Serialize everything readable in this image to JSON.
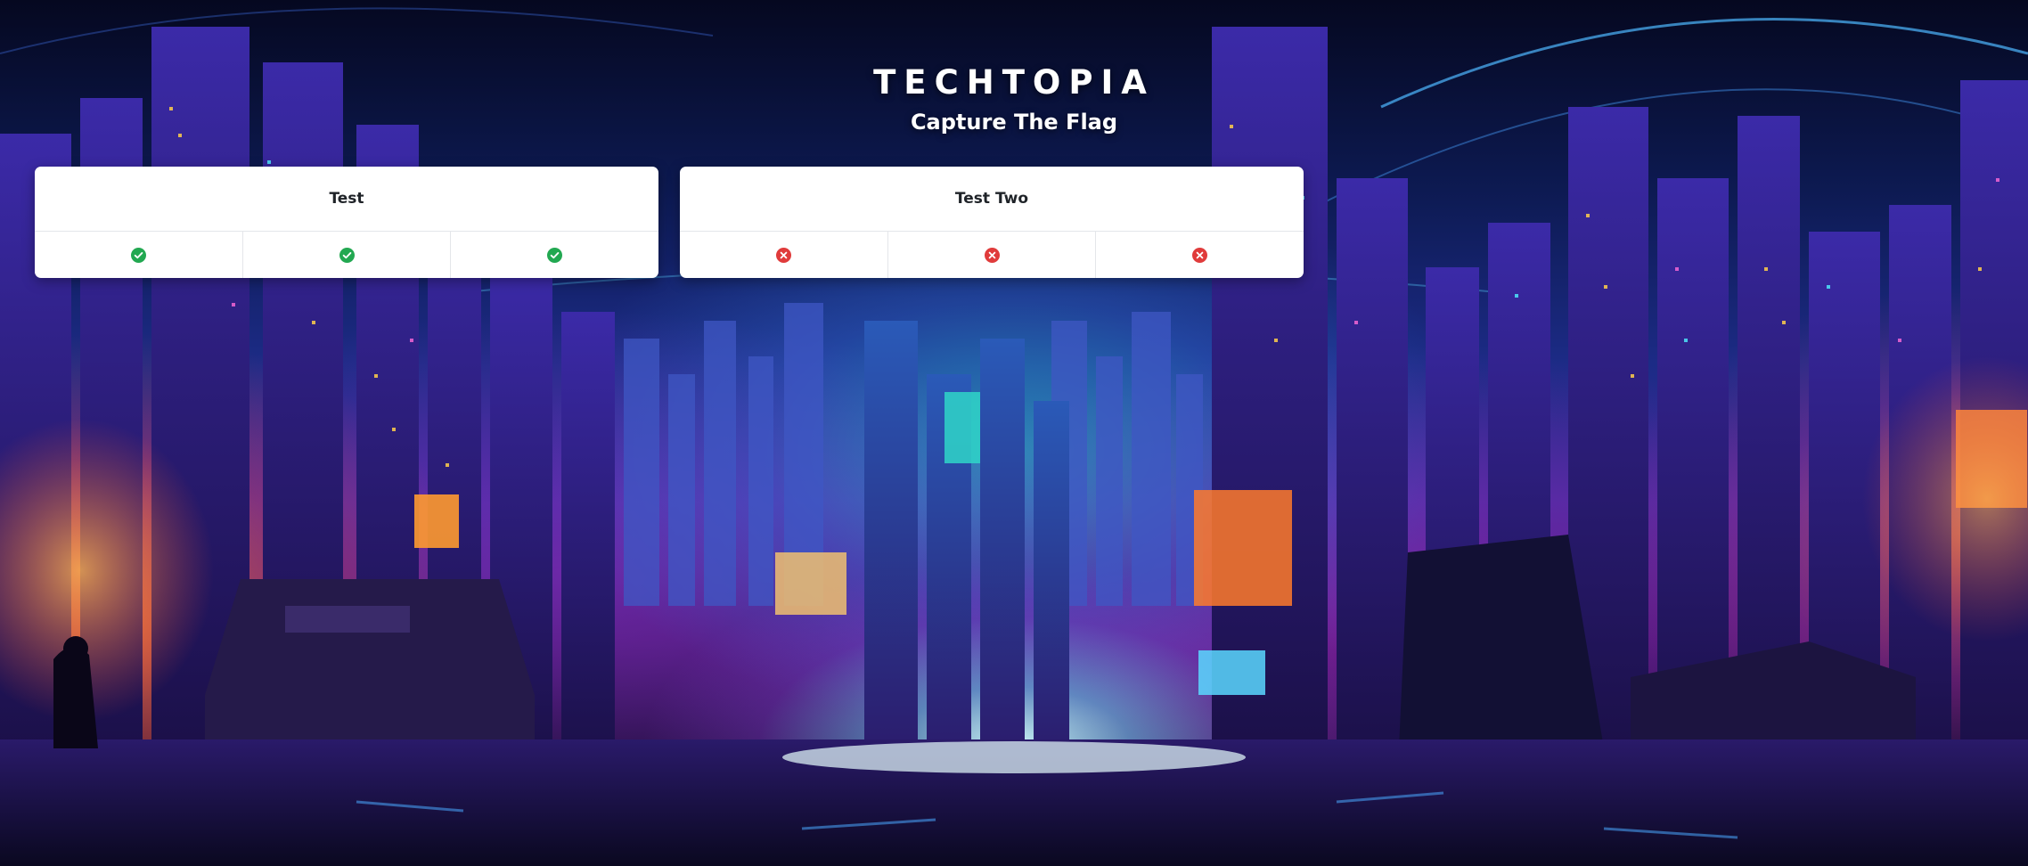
{
  "header": {
    "brand": "TECHTOPIA",
    "subtitle": "Capture The Flag"
  },
  "cards": [
    {
      "title": "Test",
      "checks": [
        {
          "status": "pass",
          "icon": "check-circle-icon"
        },
        {
          "status": "pass",
          "icon": "check-circle-icon"
        },
        {
          "status": "pass",
          "icon": "check-circle-icon"
        }
      ]
    },
    {
      "title": "Test Two",
      "checks": [
        {
          "status": "fail",
          "icon": "x-circle-icon"
        },
        {
          "status": "fail",
          "icon": "x-circle-icon"
        },
        {
          "status": "fail",
          "icon": "x-circle-icon"
        }
      ]
    }
  ],
  "colors": {
    "pass": "#22a851",
    "fail": "#e03b3b",
    "card_bg": "#ffffff",
    "text": "#ffffff"
  }
}
